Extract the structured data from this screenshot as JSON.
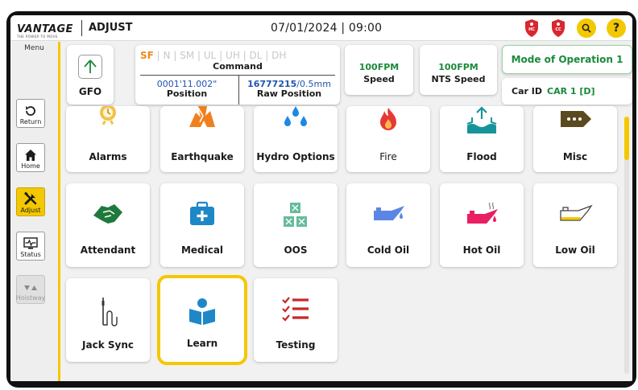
{
  "header": {
    "logo_text": "VANTAGE",
    "logo_tagline": "THE POWER TO MOVE",
    "page_name": "ADJUST",
    "datetime": "07/01/2024 | 09:00",
    "badges": [
      {
        "name": "HC",
        "color": "#d9272e"
      },
      {
        "name": "CC",
        "color": "#d9272e"
      }
    ],
    "search_icon": "search-icon",
    "help_label": "?"
  },
  "sidebar": {
    "menu_label": "Menu",
    "items": [
      {
        "label": "Return",
        "icon": "return-icon",
        "state": "normal"
      },
      {
        "label": "Home",
        "icon": "home-icon",
        "state": "normal"
      },
      {
        "label": "Adjust",
        "icon": "tools-icon",
        "state": "active"
      },
      {
        "label": "Status",
        "icon": "status-icon",
        "state": "normal"
      },
      {
        "label": "Hoistway",
        "icon": "hoistway-icon",
        "state": "disabled"
      }
    ]
  },
  "info": {
    "gfo_label": "GFO",
    "command": {
      "states": [
        "SF",
        "N",
        "SM",
        "UL",
        "UH",
        "DL",
        "DH"
      ],
      "active_state": "SF",
      "title": "Command",
      "position_value": "0001'11.002\"",
      "position_label": "Position",
      "raw_value": "16777215",
      "raw_unit": "/0.5mm",
      "raw_label": "Raw Position"
    },
    "speed": {
      "value": "100FPM",
      "label": "Speed"
    },
    "nts_speed": {
      "value": "100FPM",
      "label": "NTS Speed"
    },
    "mode": "Mode of Operation 1",
    "car_id_label": "Car ID",
    "car_id_value": "CAR 1 [D]"
  },
  "tiles": [
    {
      "label": "Alarms",
      "icon": "alarm-clock-icon"
    },
    {
      "label": "Earthquake",
      "icon": "earthquake-icon"
    },
    {
      "label": "Hydro Options",
      "icon": "water-drops-icon"
    },
    {
      "label": "Fire",
      "icon": "fire-icon"
    },
    {
      "label": "Flood",
      "icon": "flood-icon"
    },
    {
      "label": "Misc",
      "icon": "more-tag-icon"
    },
    {
      "label": "Attendant",
      "icon": "handshake-icon"
    },
    {
      "label": "Medical",
      "icon": "medical-kit-icon"
    },
    {
      "label": "OOS",
      "icon": "out-of-service-icon"
    },
    {
      "label": "Cold Oil",
      "icon": "cold-oil-can-icon"
    },
    {
      "label": "Hot Oil",
      "icon": "hot-oil-can-icon"
    },
    {
      "label": "Low Oil",
      "icon": "low-oil-can-icon"
    },
    {
      "label": "Jack Sync",
      "icon": "jack-sync-icon"
    },
    {
      "label": "Learn",
      "icon": "reader-icon",
      "selected": true
    },
    {
      "label": "Testing",
      "icon": "checklist-icon"
    }
  ],
  "colors": {
    "accent": "#f4c800",
    "green": "#1a8a3a",
    "blue": "#1f55b0",
    "orange": "#ef8a1e"
  }
}
